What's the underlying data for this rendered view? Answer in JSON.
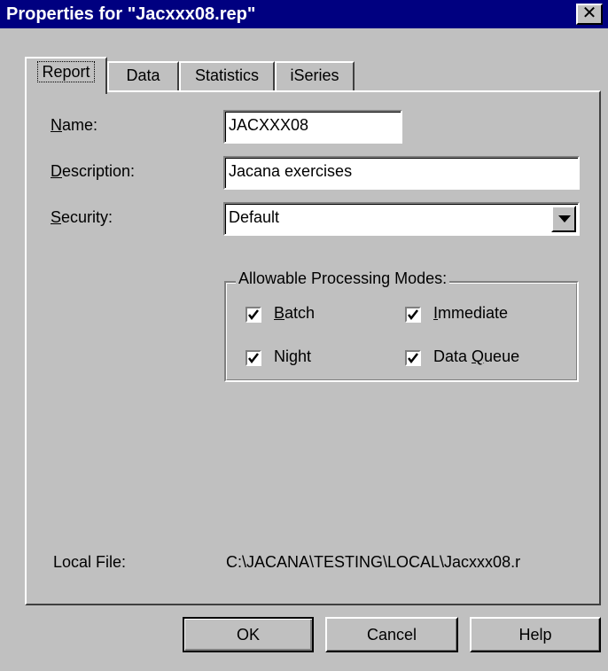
{
  "window": {
    "title": "Properties for \"Jacxxx08.rep\"",
    "close_glyph": "✕"
  },
  "tabs": [
    {
      "label": "Report",
      "active": true
    },
    {
      "label": "Data",
      "active": false
    },
    {
      "label": "Statistics",
      "active": false
    },
    {
      "label": "iSeries",
      "active": false
    }
  ],
  "form": {
    "name": {
      "label_mnemonic": "N",
      "label_rest": "ame:",
      "value": "JACXXX08"
    },
    "description": {
      "label_mnemonic": "D",
      "label_rest": "escription:",
      "value": "Jacana exercises"
    },
    "security": {
      "label_mnemonic": "S",
      "label_rest": "ecurity:",
      "value": "Default"
    }
  },
  "processing_modes": {
    "title": "Allowable Processing Modes:",
    "batch": {
      "mnemonic": "B",
      "rest": "atch",
      "checked": true
    },
    "immediate": {
      "mnemonic": "I",
      "rest": "mmediate",
      "checked": true
    },
    "night": {
      "label": "Night",
      "checked": true
    },
    "data_queue": {
      "prefix": "Data ",
      "mnemonic": "Q",
      "rest": "ueue",
      "checked": true
    }
  },
  "local_file": {
    "label": "Local File:",
    "value": "C:\\JACANA\\TESTING\\LOCAL\\Jacxxx08.r"
  },
  "buttons": {
    "ok": "OK",
    "cancel": "Cancel",
    "help": "Help"
  },
  "colors": {
    "title_bar": "#000080",
    "face": "#c0c0c0"
  }
}
